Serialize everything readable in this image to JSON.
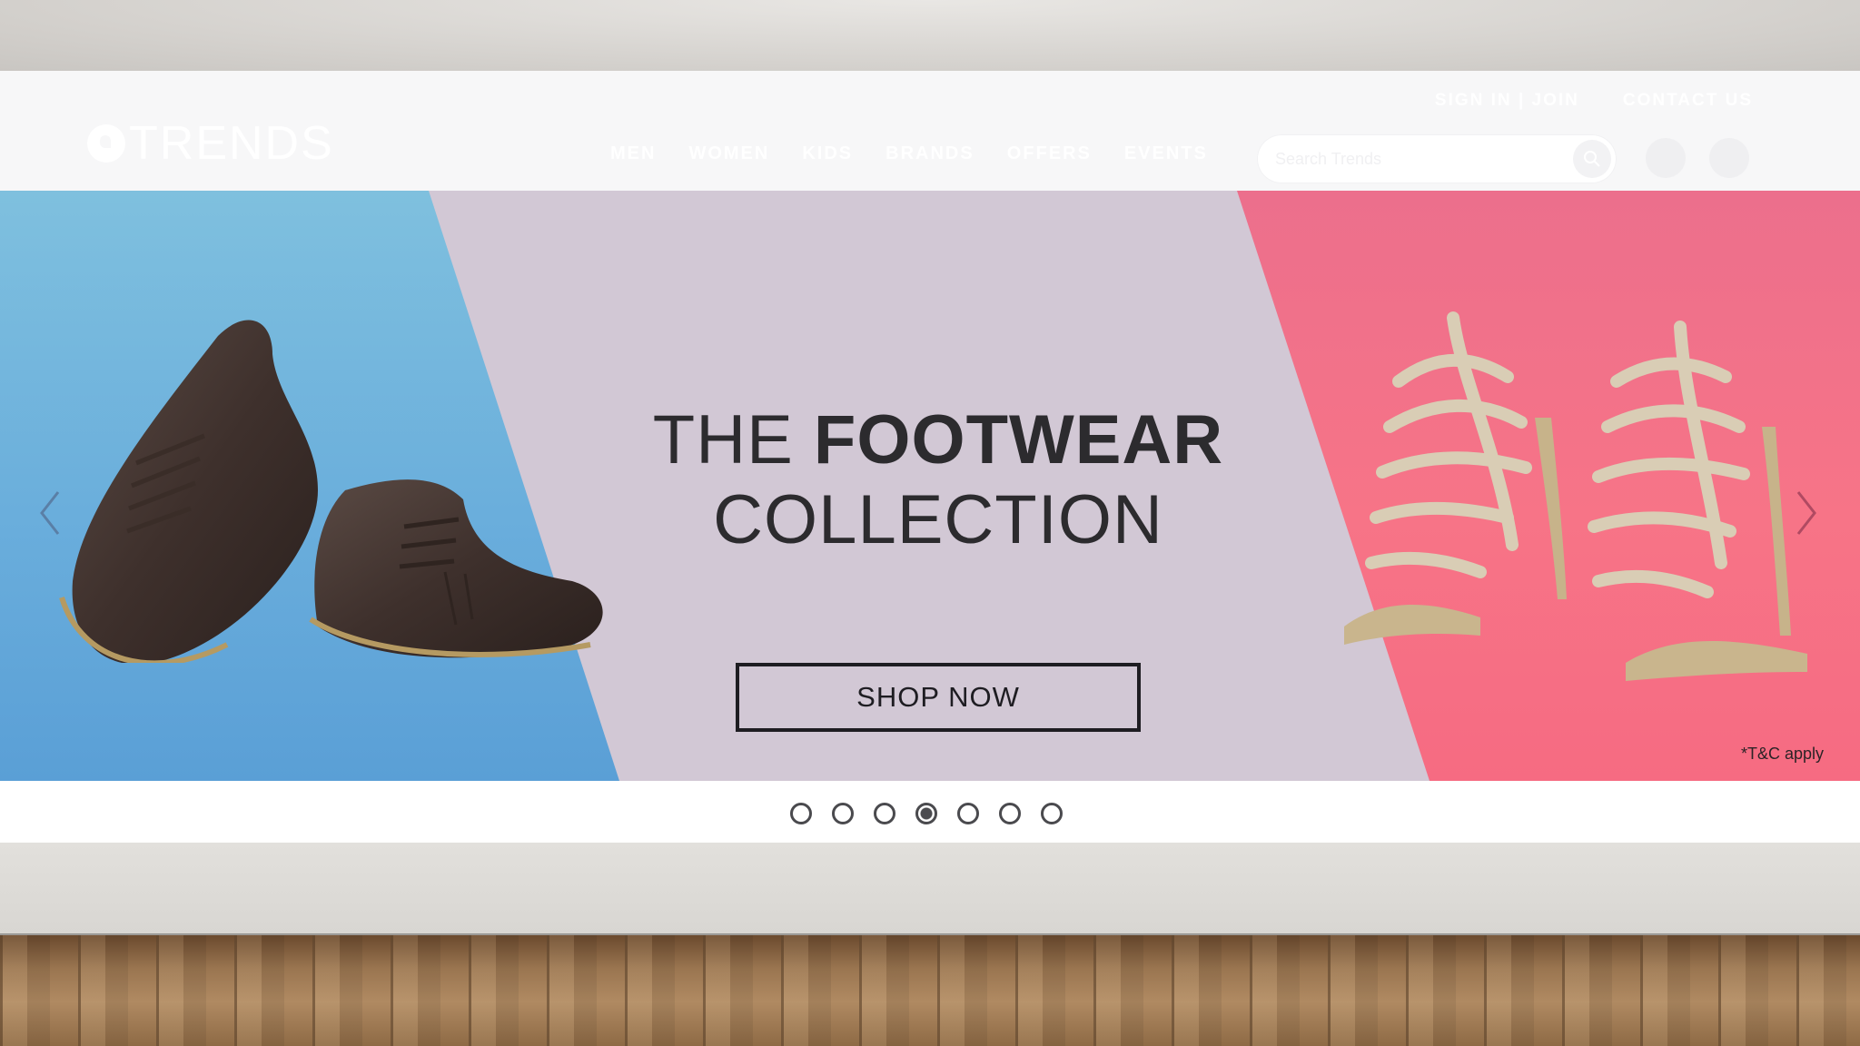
{
  "site": {
    "logo_text": "TRENDS",
    "top_links": [
      "SIGN IN | JOIN",
      "CONTACT US"
    ],
    "nav": [
      "MEN",
      "WOMEN",
      "KIDS",
      "BRANDS",
      "OFFERS",
      "EVENTS"
    ],
    "search": {
      "placeholder": "Search Trends"
    },
    "icons": [
      "search-icon",
      "user-icon",
      "bag-icon"
    ]
  },
  "banner": {
    "headline_light": "THE",
    "headline_bold": "FOOTWEAR",
    "headline_line2": "COLLECTION",
    "cta_label": "SHOP NOW",
    "terms": "*T&C apply",
    "colors": {
      "left_panel": "#6aaedc",
      "center_panel": "#d2c8d5",
      "right_panel": "#f77487",
      "text": "#2c2b2e"
    }
  },
  "carousel": {
    "slide_count": 7,
    "active_index": 4
  }
}
